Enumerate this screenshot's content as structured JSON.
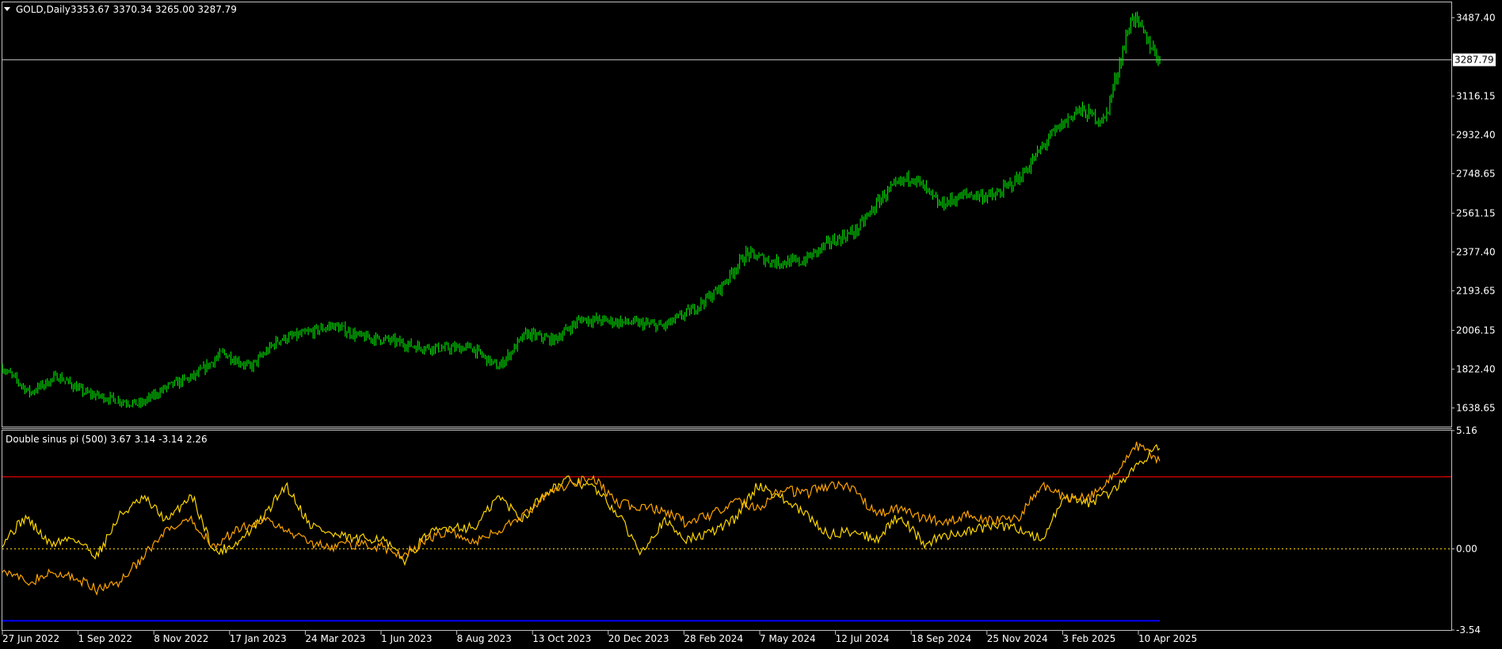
{
  "window": {
    "menu_icon": "triangle-down-icon",
    "symbol_label": "GOLD,Daily",
    "ohlc": "3353.67 3370.34 3265.00 3287.79"
  },
  "indicator": {
    "label": "Double sinus pi (500) 3.67 3.14 -3.14 2.26"
  },
  "colors": {
    "background": "#000000",
    "frame": "#c0c0c0",
    "candles": "#00ff00",
    "price_line": "#c0c0c0",
    "line1": "#ffd700",
    "line2": "#ffa500",
    "upper_level": "#ff0000",
    "lower_level": "#0000ff",
    "zero_level": "#ffd700"
  },
  "chart_data": [
    {
      "type": "candlestick",
      "title": "GOLD,Daily",
      "current_price": 3287.79,
      "current_price_label": "3287.79",
      "ylim": [
        1550.0,
        3560.0
      ],
      "y_ticks": [
        "3487.40",
        "3116.15",
        "2932.40",
        "2748.65",
        "2561.15",
        "2377.40",
        "2193.65",
        "2006.15",
        "1822.40",
        "1638.65"
      ],
      "x_ticks": [
        "27 Jun 2022",
        "1 Sep 2022",
        "8 Nov 2022",
        "17 Jan 2023",
        "24 Mar 2023",
        "1 Jun 2023",
        "8 Aug 2023",
        "13 Oct 2023",
        "20 Dec 2023",
        "28 Feb 2024",
        "7 May 2024",
        "12 Jul 2024",
        "18 Sep 2024",
        "25 Nov 2024",
        "3 Feb 2025",
        "10 Apr 2025"
      ],
      "close_path": [
        [
          "27 Jun 2022",
          1830
        ],
        [
          "Jul 2022",
          1710
        ],
        [
          "Aug 2022",
          1790
        ],
        [
          "1 Sep 2022",
          1710
        ],
        [
          "Sep 2022",
          1680
        ],
        [
          "Oct 2022",
          1655
        ],
        [
          "8 Nov 2022",
          1740
        ],
        [
          "Dec 2022",
          1790
        ],
        [
          "17 Jan 2023",
          1900
        ],
        [
          "Feb 2023",
          1830
        ],
        [
          "Mar 2023",
          1960
        ],
        [
          "24 Mar 2023",
          1990
        ],
        [
          "Apr 2023",
          2030
        ],
        [
          "May 2023",
          1975
        ],
        [
          "1 Jun 2023",
          1960
        ],
        [
          "Jul 2023",
          1930
        ],
        [
          "8 Aug 2023",
          1920
        ],
        [
          "Sep 2023",
          1925
        ],
        [
          "Oct 2023",
          1830
        ],
        [
          "13 Oct 2023",
          1990
        ],
        [
          "Nov 2023",
          1960
        ],
        [
          "Dec 2023",
          2060
        ],
        [
          "20 Dec 2023",
          2050
        ],
        [
          "Jan 2024",
          2040
        ],
        [
          "Feb 2024",
          2025
        ],
        [
          "28 Feb 2024",
          2100
        ],
        [
          "Mar 2024",
          2200
        ],
        [
          "Apr 2024",
          2370
        ],
        [
          "7 May 2024",
          2330
        ],
        [
          "Jun 2024",
          2330
        ],
        [
          "12 Jul 2024",
          2420
        ],
        [
          "Aug 2024",
          2480
        ],
        [
          "18 Sep 2024",
          2650
        ],
        [
          "Oct 2024",
          2740
        ],
        [
          "Nov 2024",
          2600
        ],
        [
          "25 Nov 2024",
          2650
        ],
        [
          "Dec 2024",
          2640
        ],
        [
          "Jan 2025",
          2740
        ],
        [
          "3 Feb 2025",
          2920
        ],
        [
          "Mar 2025",
          3050
        ],
        [
          "Apr 2025",
          3000
        ],
        [
          "10 Apr 2025",
          3500
        ],
        [
          "end",
          3287.79
        ]
      ]
    },
    {
      "type": "line",
      "title": "Double sinus pi (500)",
      "ylim": [
        -3.54,
        5.16
      ],
      "y_ticks": [
        "5.16",
        "0.00",
        "-3.54"
      ],
      "levels": [
        3.14,
        0.0,
        -3.14
      ],
      "series": [
        {
          "values": [
            0.3,
            1.4,
            0.2,
            0.5,
            -0.3,
            1.5,
            2.2,
            1.2,
            2.4,
            -0.2,
            0.3,
            1.3,
            2.8,
            1.1,
            0.6,
            0.4,
            0.5,
            -0.5,
            0.6,
            1.0,
            0.9,
            2.3,
            1.3,
            2.5,
            3.0,
            2.7,
            1.6,
            -0.1,
            1.2,
            0.4,
            0.7,
            1.3,
            2.8,
            2.2,
            1.5,
            0.6,
            0.8,
            0.4,
            1.5,
            0.2,
            0.6,
            0.8,
            1.0,
            0.9,
            0.4,
            2.2,
            2.0,
            2.5,
            3.6,
            4.6
          ]
        },
        {
          "values": [
            -0.8,
            -1.5,
            -1.1,
            -1.2,
            -1.8,
            -1.4,
            -0.3,
            0.8,
            1.2,
            0.1,
            0.9,
            1.3,
            0.8,
            0.3,
            0.1,
            0.2,
            0.1,
            -0.3,
            0.5,
            0.7,
            0.3,
            0.8,
            1.4,
            2.3,
            2.8,
            3.2,
            2.0,
            1.8,
            1.7,
            1.1,
            1.5,
            2.1,
            1.8,
            2.6,
            2.4,
            2.8,
            2.6,
            1.5,
            1.8,
            1.3,
            1.2,
            1.5,
            1.2,
            1.3,
            2.8,
            2.2,
            2.2,
            3.2,
            4.5,
            3.9
          ]
        }
      ]
    }
  ]
}
